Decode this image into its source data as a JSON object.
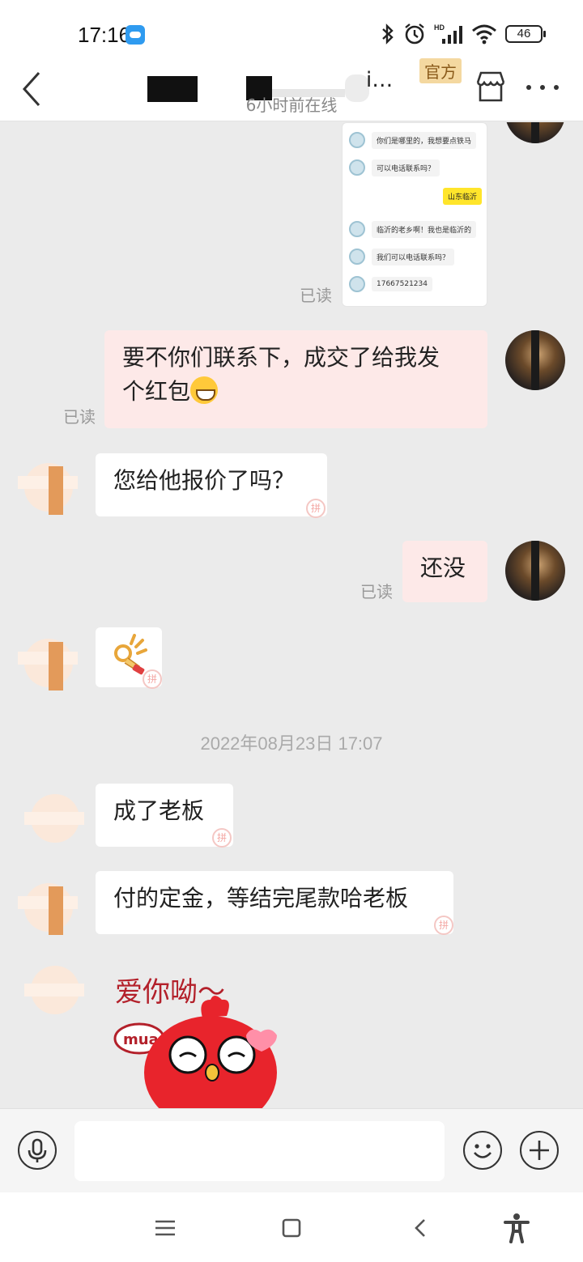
{
  "status_bar": {
    "time": "17:16",
    "battery": "46",
    "network": "HD"
  },
  "header": {
    "title_tail": "i…",
    "badge": "官方",
    "subtitle": "6小时前在线"
  },
  "forwarded_screenshot": {
    "rows": [
      "你们是哪里的，我想要点铁马",
      "可以电话联系吗？",
      "临沂的老乡啊！我也是临沂的",
      "我们可以电话联系吗？",
      "17667521234"
    ],
    "reply": "山东临沂"
  },
  "messages": {
    "m1": "要不你们联系下，成交了给我发",
    "m1b": "个红包",
    "m2": "您给他报价了吗？",
    "m3": "还没",
    "m4": "成了老板",
    "m5": "付的定金，等结完尾款哈老板"
  },
  "read_label": "已读",
  "timestamp": "2022年08月23日 17:07",
  "sticker": {
    "caption": "爱你呦～",
    "bubble_text": "mua"
  },
  "input": {
    "placeholder": ""
  },
  "colors": {
    "my_bubble": "#fde9e8",
    "their_bubble": "#ffffff",
    "badge": "#f4d8a0"
  }
}
